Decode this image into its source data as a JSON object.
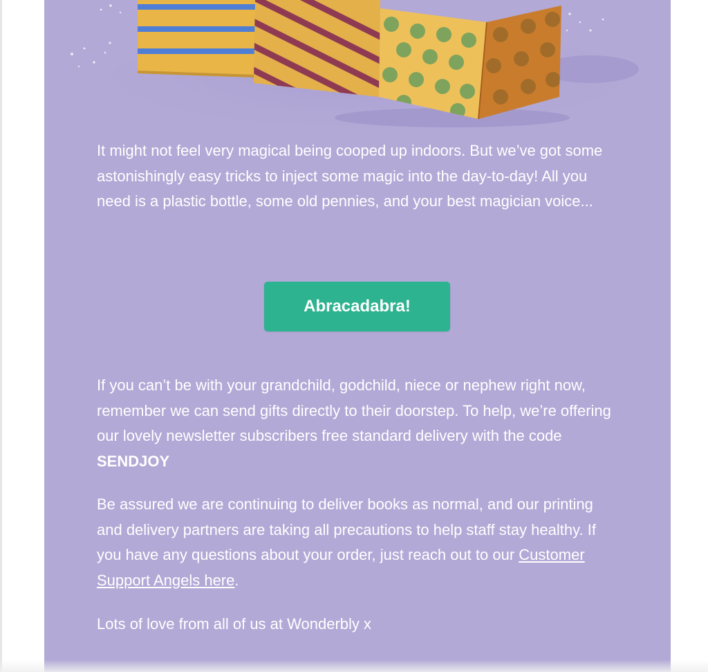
{
  "colors": {
    "card_background": "#b2a9d6",
    "button_background": "#2db38f",
    "text": "#ffffff"
  },
  "hero": {
    "illustration": "three-patterned-gift-boxes"
  },
  "intro": {
    "text": "It might not feel very magical being cooped up indoors. But we’ve got some astonishingly easy tricks to inject some magic into the day-to-day! All you need is a plastic bottle, some old pennies, and your best magician voice..."
  },
  "cta": {
    "label": "Abracadabra!"
  },
  "delivery": {
    "text": "If you can’t be with your grandchild, godchild, niece or nephew right now, remember we can send gifts directly to their doorstep. To help, we’re offering our lovely newsletter subscribers free standard delivery with the code ",
    "code": "SENDJOY"
  },
  "assurance": {
    "text": "Be assured we are continuing to deliver books as normal, and our printing and delivery partners are taking all precautions to help staff stay healthy. If you have any questions about your order, just reach out to our ",
    "link_label": "Customer Support Angels here",
    "suffix": "."
  },
  "signoff": {
    "text": "Lots of love from all of us at Wonderbly x"
  }
}
